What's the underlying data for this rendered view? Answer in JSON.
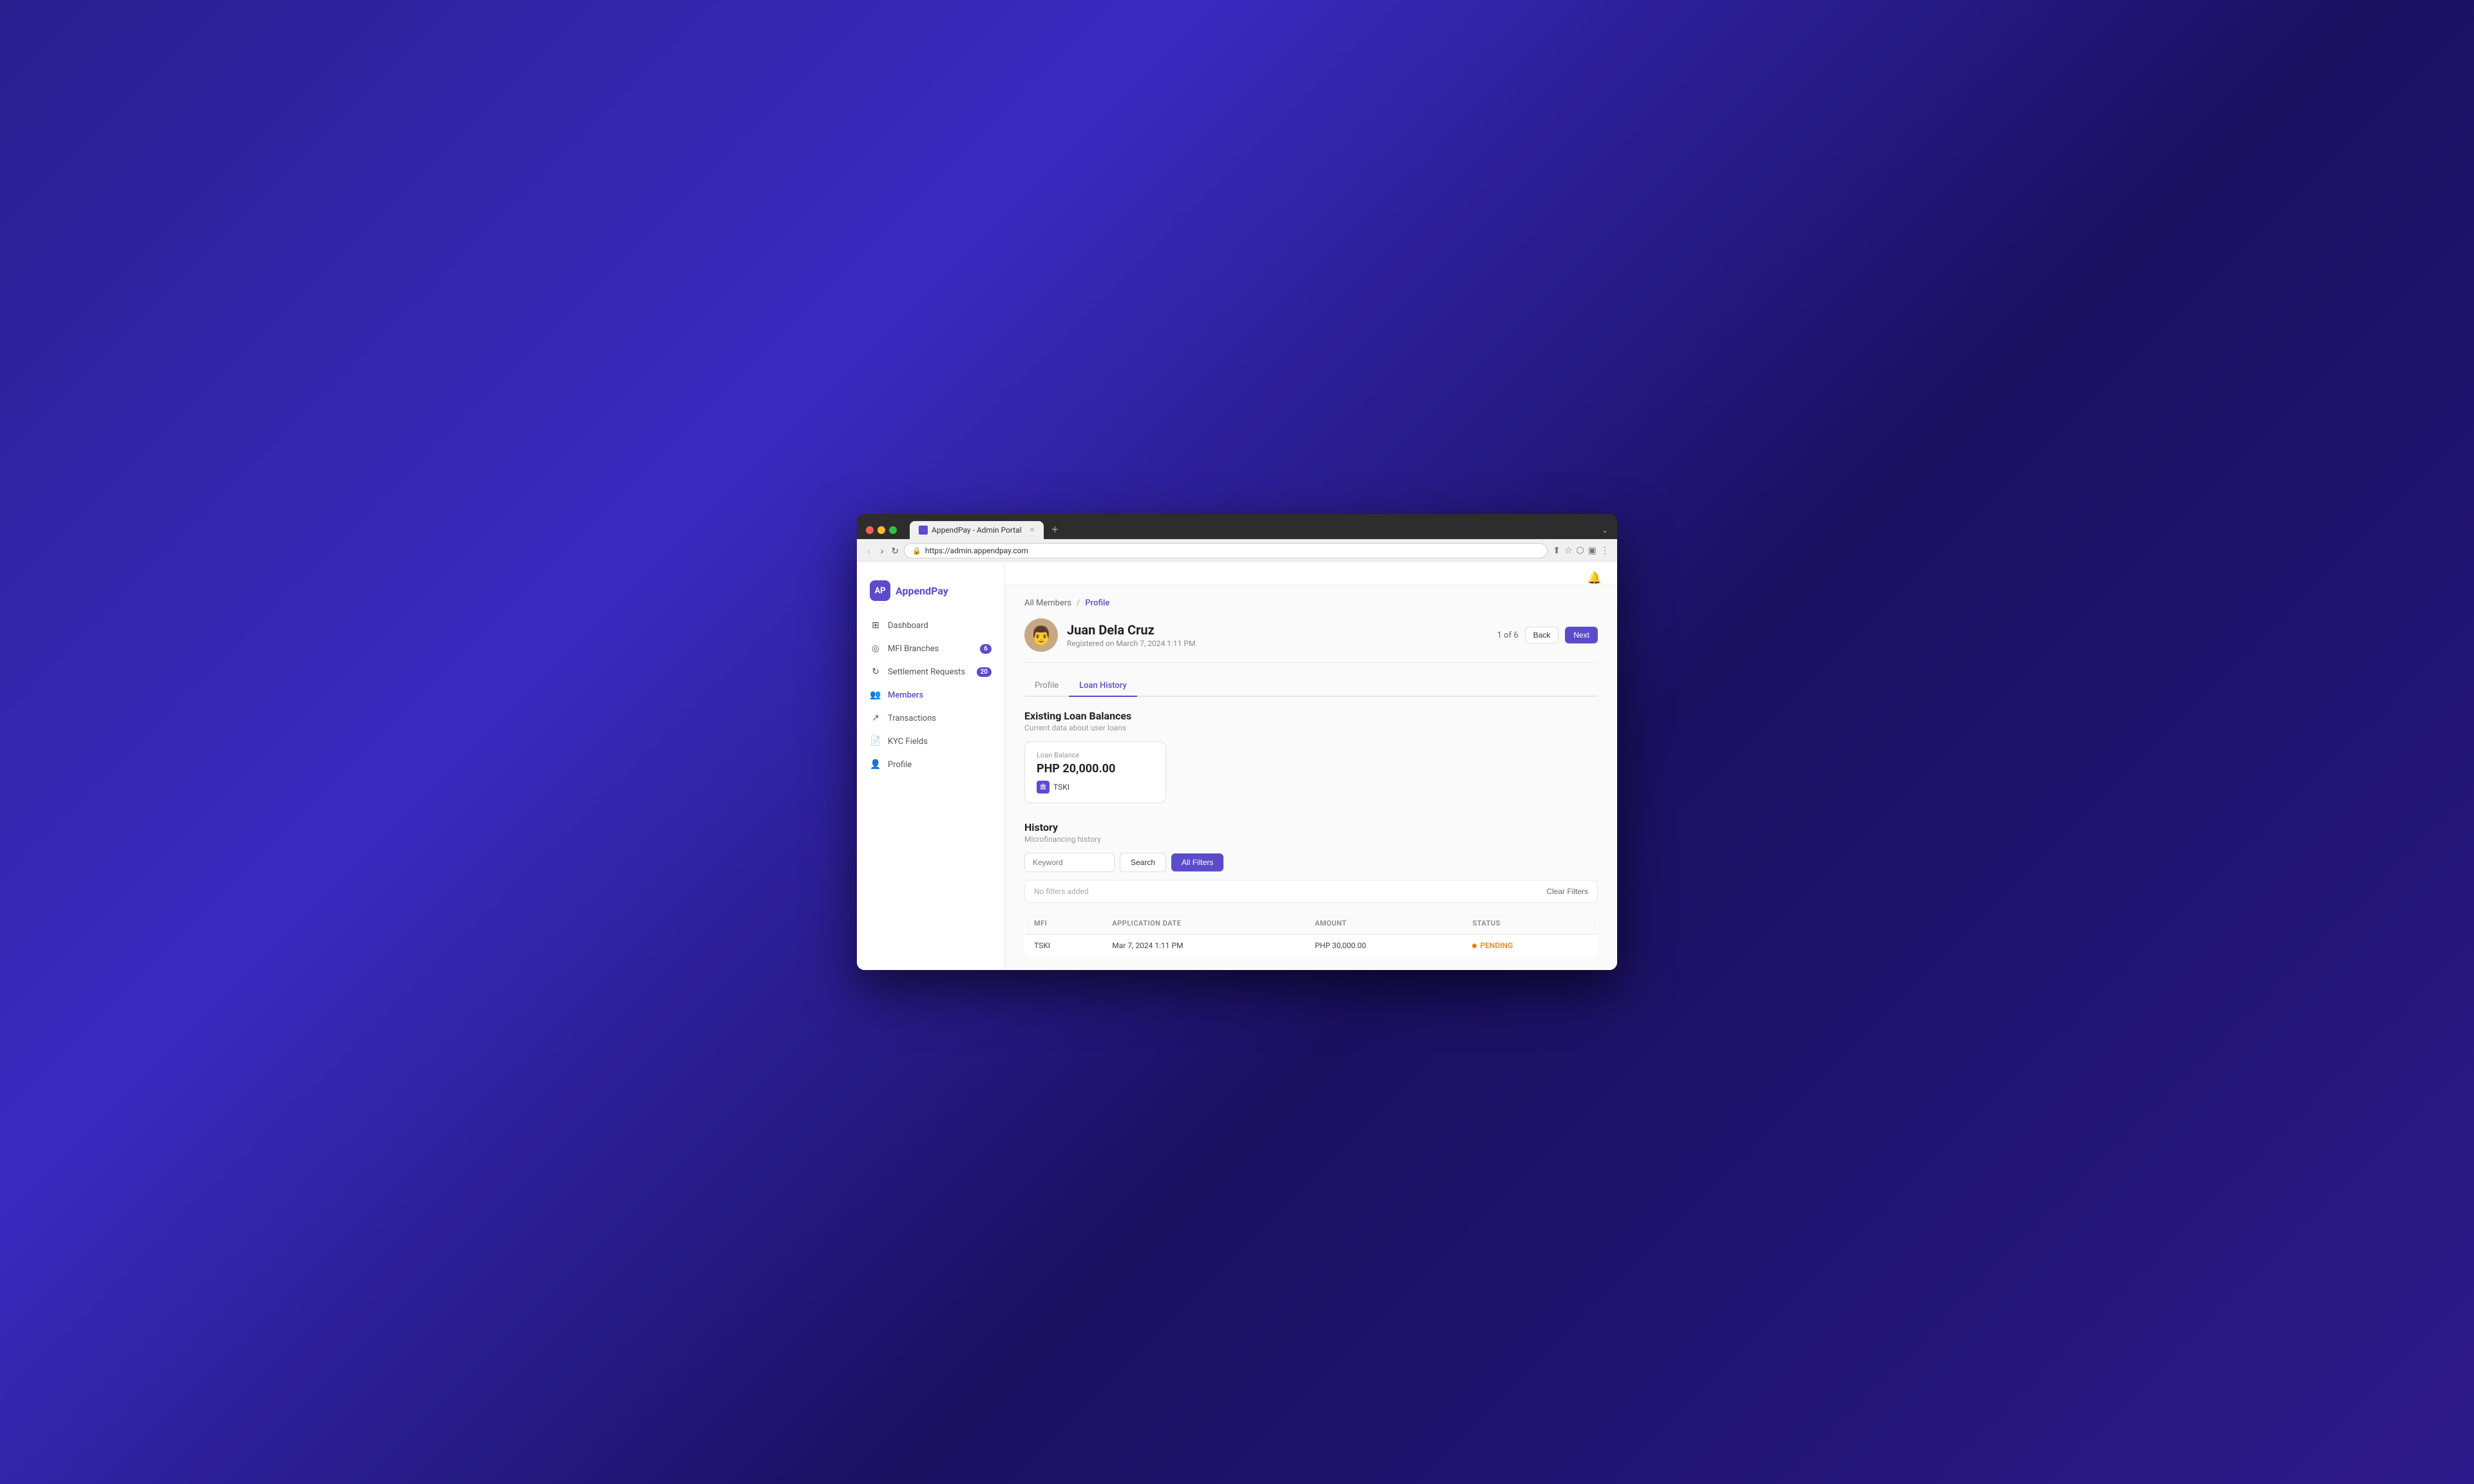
{
  "browser": {
    "tab_title": "AppendPay - Admin Portal",
    "url": "https://admin.appendpay.com",
    "new_tab_icon": "+"
  },
  "app": {
    "logo_initials": "AP",
    "logo_name": "AppendPay"
  },
  "sidebar": {
    "items": [
      {
        "id": "dashboard",
        "label": "Dashboard",
        "icon": "⊞",
        "badge": null
      },
      {
        "id": "mfi-branches",
        "label": "MFI Branches",
        "icon": "◎",
        "badge": "6"
      },
      {
        "id": "settlement-requests",
        "label": "Settlement Requests",
        "icon": "↻",
        "badge": "20"
      },
      {
        "id": "members",
        "label": "Members",
        "icon": "👥",
        "badge": null
      },
      {
        "id": "transactions",
        "label": "Transactions",
        "icon": "↗",
        "badge": null
      },
      {
        "id": "kyc-fields",
        "label": "KYC Fields",
        "icon": "📄",
        "badge": null
      },
      {
        "id": "profile",
        "label": "Profile",
        "icon": "👤",
        "badge": null
      }
    ]
  },
  "breadcrumb": {
    "parent": "All Members",
    "separator": "/",
    "current": "Profile"
  },
  "profile": {
    "name": "Juan Dela Cruz",
    "registered_label": "Registered on March 7, 2024 1:11 PM",
    "avatar_emoji": "👨",
    "pagination": {
      "current": "1 of 6",
      "back_label": "Back",
      "next_label": "Next"
    }
  },
  "tabs": [
    {
      "id": "profile-tab",
      "label": "Profile"
    },
    {
      "id": "loan-history-tab",
      "label": "Loan History"
    }
  ],
  "loan_section": {
    "title": "Existing Loan Balances",
    "subtitle": "Current data about user loans",
    "card": {
      "label": "Loan Balance",
      "amount": "PHP 20,000.00",
      "org_name": "TSKI",
      "org_icon": "🏛"
    }
  },
  "history_section": {
    "title": "History",
    "subtitle": "Microfinancing history",
    "search": {
      "keyword_placeholder": "Keyword",
      "search_label": "Search",
      "filters_label": "All Filters"
    },
    "filter_bar": {
      "empty_text": "No filters added",
      "clear_label": "Clear Filters"
    },
    "table": {
      "columns": [
        "MFI",
        "APPLICATION DATE",
        "AMOUNT",
        "STATUS"
      ],
      "rows": [
        {
          "mfi": "TSKI",
          "application_date": "Mar 7, 2024 1:11 PM",
          "amount": "PHP 30,000.00",
          "status": "PENDING"
        }
      ]
    }
  }
}
